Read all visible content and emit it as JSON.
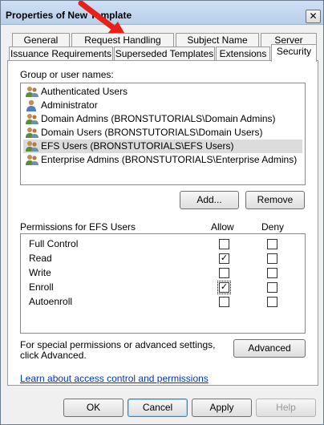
{
  "window": {
    "title": "Properties of New Template",
    "close_glyph": "✕"
  },
  "tabs_back": [
    {
      "label": "General"
    },
    {
      "label": "Request Handling"
    },
    {
      "label": "Subject Name"
    },
    {
      "label": "Server"
    }
  ],
  "tabs_front": [
    {
      "label": "Issuance Requirements"
    },
    {
      "label": "Superseded Templates"
    },
    {
      "label": "Extensions"
    },
    {
      "label": "Security",
      "active": true
    }
  ],
  "security": {
    "group_label": "Group or user names:",
    "users": [
      {
        "name": "Authenticated Users",
        "icon": "group-icon"
      },
      {
        "name": "Administrator",
        "icon": "user-icon"
      },
      {
        "name": "Domain Admins (BRONSTUTORIALS\\Domain Admins)",
        "icon": "group-icon"
      },
      {
        "name": "Domain Users (BRONSTUTORIALS\\Domain Users)",
        "icon": "group-icon"
      },
      {
        "name": "EFS Users (BRONSTUTORIALS\\EFS Users)",
        "icon": "group-icon",
        "selected": true
      },
      {
        "name": "Enterprise Admins (BRONSTUTORIALS\\Enterprise Admins)",
        "icon": "group-icon"
      }
    ],
    "add_label": "Add...",
    "remove_label": "Remove",
    "permissions_label": "Permissions for EFS Users",
    "allow_label": "Allow",
    "deny_label": "Deny",
    "permissions": [
      {
        "name": "Full Control",
        "allow": false,
        "deny": false
      },
      {
        "name": "Read",
        "allow": true,
        "deny": false
      },
      {
        "name": "Write",
        "allow": false,
        "deny": false
      },
      {
        "name": "Enroll",
        "allow": true,
        "deny": false
      },
      {
        "name": "Autoenroll",
        "allow": false,
        "deny": false
      }
    ],
    "special_text": "For special permissions or advanced settings, click Advanced.",
    "advanced_label": "Advanced",
    "learn_link": "Learn about access control and permissions"
  },
  "footer": {
    "ok_label": "OK",
    "cancel_label": "Cancel",
    "apply_label": "Apply",
    "help_label": "Help"
  },
  "colors": {
    "arrow": "#e8201b",
    "link": "#0033cc",
    "selected_row": "#dcdcdc"
  }
}
